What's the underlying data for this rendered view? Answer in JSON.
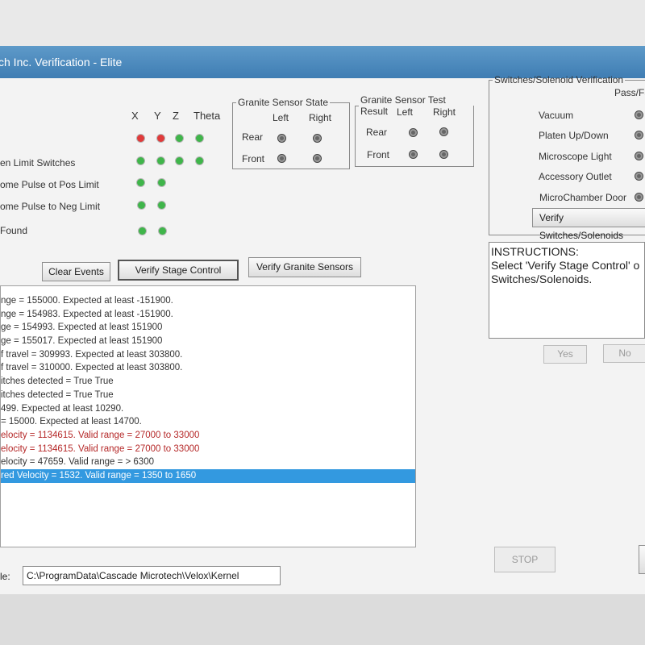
{
  "window": {
    "title": "ch Inc.   Verification - Elite"
  },
  "axes": {
    "headers": [
      "X",
      "Y",
      "Z",
      "Theta"
    ]
  },
  "status_rows": [
    {
      "label": ""
    },
    {
      "label": "en Limit Switches"
    },
    {
      "label": "ome Pulse ot Pos Limit"
    },
    {
      "label": "ome Pulse to Neg Limit"
    },
    {
      "label": "Found"
    }
  ],
  "granite_state": {
    "title": "Granite Sensor State",
    "cols": [
      "Left",
      "Right"
    ],
    "rows": [
      "Rear",
      "Front"
    ]
  },
  "granite_result": {
    "title": "Granite Sensor Test Result",
    "cols": [
      "Left",
      "Right"
    ],
    "rows": [
      "Rear",
      "Front"
    ]
  },
  "switches": {
    "title": "Switches/Solenoid Verification",
    "pass_header": "Pass/Fa",
    "items": [
      "Vacuum",
      "Platen Up/Down",
      "Microscope Light",
      "Accessory Outlet",
      "MicroChamber Door"
    ],
    "verify_label": "Verify Switches/Solenoids"
  },
  "buttons": {
    "clear_events": "Clear Events",
    "verify_stage": "Verify Stage Control",
    "verify_granite": "Verify Granite Sensors",
    "yes": "Yes",
    "no": "No",
    "stop": "STOP"
  },
  "instructions": {
    "heading": "INSTRUCTIONS:",
    "line1": "Select 'Verify Stage Control' o",
    "line2": "Switches/Solenoids."
  },
  "log": [
    {
      "text": "nge = 155000.  Expected at least -151900.",
      "kind": "ok"
    },
    {
      "text": "nge = 154983.  Expected at least -151900.",
      "kind": "ok"
    },
    {
      "text": "ge = 154993.  Expected at least 151900",
      "kind": "ok"
    },
    {
      "text": "ge = 155017.  Expected at least 151900",
      "kind": "ok"
    },
    {
      "text": "f travel = 309993.  Expected at least 303800.",
      "kind": "ok"
    },
    {
      "text": "f travel = 310000.  Expected at least 303800.",
      "kind": "ok"
    },
    {
      "text": "itches detected = True True",
      "kind": "ok"
    },
    {
      "text": "itches detected = True True",
      "kind": "ok"
    },
    {
      "text": "499.  Expected at least 10290.",
      "kind": "ok"
    },
    {
      "text": "= 15000.  Expected at least 14700.",
      "kind": "ok"
    },
    {
      "text": "elocity = 1134615.  Valid range = 27000 to 33000",
      "kind": "err"
    },
    {
      "text": "elocity = 1134615.  Valid range = 27000 to 33000",
      "kind": "err"
    },
    {
      "text": "elocity = 47659.  Valid range = > 6300",
      "kind": "ok"
    },
    {
      "text": "red Velocity = 1532.  Valid range = 1350 to 1650",
      "kind": "sel"
    }
  ],
  "file": {
    "label": "le:",
    "path": "C:\\ProgramData\\Cascade Microtech\\Velox\\Kernel"
  },
  "colors": {
    "led_red": "#e03a3a",
    "led_green": "#3fb54a",
    "selection": "#3399e0",
    "error_text": "#b52828"
  }
}
